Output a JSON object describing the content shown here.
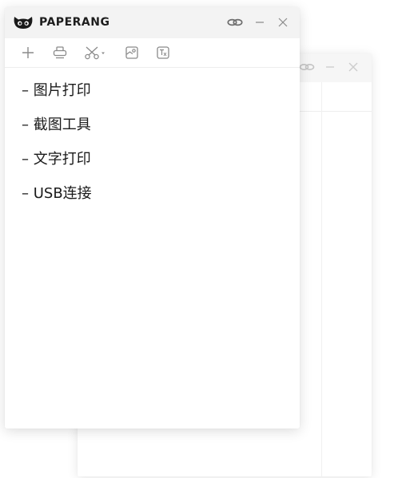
{
  "app": {
    "title": "PAPERANG"
  },
  "icons": {
    "logo": "cat-logo-icon",
    "link": "link-icon",
    "minimize": "minimize-icon",
    "close": "close-icon",
    "add": "plus-icon",
    "print": "printer-icon",
    "cut": "scissors-icon",
    "cut_dropdown": "caret-down-icon",
    "image": "image-icon",
    "text": "text-format-icon"
  },
  "colors": {
    "titlebar_bg": "#f3f3f3",
    "icon": "#8a8a8a",
    "text": "#1a1a1a",
    "logo": "#1a1a1a"
  },
  "content": {
    "lines": [
      "– 图片打印",
      "– 截图工具",
      "– 文字打印",
      "– USB连接"
    ]
  }
}
